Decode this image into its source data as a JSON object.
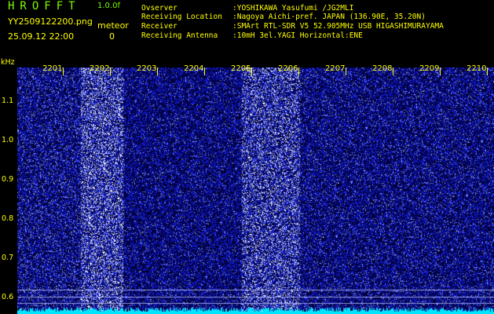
{
  "header": {
    "brand": "HROFFT",
    "version": "1.0.0f",
    "filename": "YY2509122200.png",
    "datetime": "25.09.12 22:00",
    "meteor_label": "meteor",
    "meteor_count": "0"
  },
  "info": [
    {
      "key": "Ovserver",
      "value": ":YOSHIKAWA Yasufumi /JG2MLI"
    },
    {
      "key": "Receiving Location",
      "value": ":Nagoya Aichi-pref. JAPAN (136.90E, 35.20N)"
    },
    {
      "key": "Receiver",
      "value": ":SMArt RTL-SDR V5 52.905MHz USB HIGASHIMURAYAMA"
    },
    {
      "key": "Receiving Antenna",
      "value": ":10mH 3el.YAGI Horizontal:ENE"
    }
  ],
  "axis": {
    "y_unit": "kHz",
    "y_labels": [
      "1.1",
      "1.0",
      "0.9",
      "0.8",
      "0.7",
      "0.6"
    ],
    "x_labels": [
      "2201",
      "2202",
      "2203",
      "2204",
      "2205",
      "2206",
      "2207",
      "2208",
      "2209",
      "2210"
    ]
  },
  "colors": {
    "label": "#FFFF00",
    "brand": "#7CFC00",
    "waterfall_bg": "#00003a",
    "noise": "#3a4cff",
    "bright": "#ffffff",
    "baseline": "#00e5ff"
  }
}
